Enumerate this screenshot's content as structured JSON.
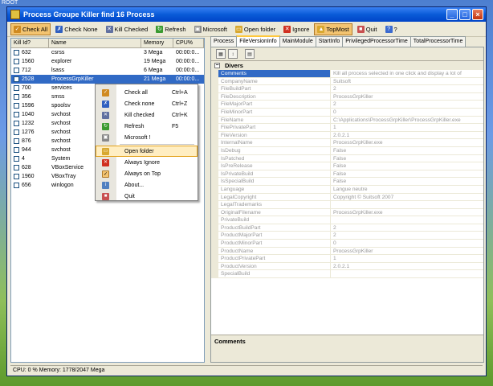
{
  "desktop_label": "ROOT",
  "window": {
    "title": "Process Groupe Killer find 16 Process",
    "buttons": [
      "_",
      "□",
      "×"
    ]
  },
  "toolbar": [
    {
      "label": "Check All",
      "icon": "check-all-icon",
      "color": "#d08a20",
      "pressed": true
    },
    {
      "label": "Check None",
      "icon": "check-none-icon",
      "color": "#3060c0",
      "pressed": false
    },
    {
      "label": "Kill Checked",
      "icon": "kill-icon",
      "color": "#6070a0",
      "pressed": false
    },
    {
      "label": "Refresh",
      "icon": "refresh-icon",
      "color": "#3a9a30",
      "pressed": false
    },
    {
      "label": "Microsoft",
      "icon": "microsoft-icon",
      "color": "#888888",
      "pressed": false
    },
    {
      "label": "Open folder",
      "icon": "folder-icon",
      "color": "#d8a830",
      "pressed": false
    },
    {
      "label": "Ignore",
      "icon": "ignore-icon",
      "color": "#d03020",
      "pressed": false
    },
    {
      "label": "TopMost",
      "icon": "topmost-icon",
      "color": "#d8a830",
      "pressed": true
    },
    {
      "label": "Quit",
      "icon": "quit-icon",
      "color": "#c85050",
      "pressed": false
    },
    {
      "label": "?",
      "icon": "help-icon",
      "color": "#3a6ad0",
      "pressed": false
    }
  ],
  "process_list": {
    "columns": [
      "Kill Id?",
      "Name",
      "Memory",
      "CPU%"
    ],
    "rows": [
      {
        "id": "632",
        "name": "csrss",
        "memory": "3 Mega",
        "cpu": "00:00:0..."
      },
      {
        "id": "1560",
        "name": "explorer",
        "memory": "19 Mega",
        "cpu": "00:00:0..."
      },
      {
        "id": "712",
        "name": "lsass",
        "memory": "6 Mega",
        "cpu": "00:00:0..."
      },
      {
        "id": "2528",
        "name": "ProcessGrpKiller",
        "memory": "21 Mega",
        "cpu": "00:00:0..."
      },
      {
        "id": "700",
        "name": "services",
        "memory": "",
        "cpu": ""
      },
      {
        "id": "356",
        "name": "smss",
        "memory": "",
        "cpu": ""
      },
      {
        "id": "1596",
        "name": "spoolsv",
        "memory": "",
        "cpu": ""
      },
      {
        "id": "1040",
        "name": "svchost",
        "memory": "",
        "cpu": ""
      },
      {
        "id": "1232",
        "name": "svchost",
        "memory": "",
        "cpu": ""
      },
      {
        "id": "1276",
        "name": "svchost",
        "memory": "",
        "cpu": ""
      },
      {
        "id": "876",
        "name": "svchost",
        "memory": "",
        "cpu": ""
      },
      {
        "id": "944",
        "name": "svchost",
        "memory": "",
        "cpu": ""
      },
      {
        "id": "4",
        "name": "System",
        "memory": "",
        "cpu": ""
      },
      {
        "id": "628",
        "name": "VBoxService",
        "memory": "",
        "cpu": ""
      },
      {
        "id": "1960",
        "name": "VBoxTray",
        "memory": "",
        "cpu": ""
      },
      {
        "id": "656",
        "name": "winlogon",
        "memory": "",
        "cpu": ""
      }
    ]
  },
  "context_menu": [
    {
      "label": "Check all",
      "shortcut": "Ctrl+A",
      "icon": "check-all-icon",
      "color": "#d08a20"
    },
    {
      "label": "Check none",
      "shortcut": "Ctrl+Z",
      "icon": "check-none-icon",
      "color": "#3060c0"
    },
    {
      "label": "Kill checked",
      "shortcut": "Ctrl+K",
      "icon": "kill-icon",
      "color": "#6070a0"
    },
    {
      "label": "Refresh",
      "shortcut": "F5",
      "icon": "refresh-icon",
      "color": "#3a9a30"
    },
    {
      "label": "Microsoft !",
      "shortcut": "",
      "icon": "microsoft-icon",
      "color": "#888888"
    },
    {
      "sep": true
    },
    {
      "label": "Open folder",
      "shortcut": "",
      "icon": "folder-icon",
      "color": "#d8a830",
      "highlight": true
    },
    {
      "label": "Always Ignore",
      "shortcut": "",
      "icon": "ignore-icon",
      "color": "#d03020"
    },
    {
      "label": "Always on Top",
      "shortcut": "",
      "icon": "topmost-icon",
      "color": "#d8a830",
      "checked": true
    },
    {
      "label": "About...",
      "shortcut": "",
      "icon": "about-icon",
      "color": "#5080c0"
    },
    {
      "label": "Quit",
      "shortcut": "",
      "icon": "quit-icon",
      "color": "#c85050"
    }
  ],
  "tabs": [
    "Process",
    "FileVersionInfo",
    "MainModule",
    "StartInfo",
    "PrivilegedProcessorTime",
    "TotalProcessorTime"
  ],
  "active_tab": "FileVersionInfo",
  "property_grid": {
    "category": "Divers",
    "rows": [
      {
        "name": "Comments",
        "value": "Kill all process selected in one click and display a lot of"
      },
      {
        "name": "CompanyName",
        "value": "Suitsoft"
      },
      {
        "name": "FileBuildPart",
        "value": "2"
      },
      {
        "name": "FileDescription",
        "value": "ProcessGrpKiller"
      },
      {
        "name": "FileMajorPart",
        "value": "2"
      },
      {
        "name": "FileMinorPart",
        "value": "0"
      },
      {
        "name": "FileName",
        "value": "C:\\Applications\\ProcessGrpKiller\\ProcessGrpKiller.exe"
      },
      {
        "name": "FilePrivatePart",
        "value": "1"
      },
      {
        "name": "FileVersion",
        "value": "2.0.2.1"
      },
      {
        "name": "InternalName",
        "value": "ProcessGrpKiller.exe"
      },
      {
        "name": "IsDebug",
        "value": "False"
      },
      {
        "name": "IsPatched",
        "value": "False"
      },
      {
        "name": "IsPreRelease",
        "value": "False"
      },
      {
        "name": "IsPrivateBuild",
        "value": "False"
      },
      {
        "name": "IsSpecialBuild",
        "value": "False"
      },
      {
        "name": "Language",
        "value": "Langue neutre"
      },
      {
        "name": "LegalCopyright",
        "value": "Copyright © Suitsoft 2007"
      },
      {
        "name": "LegalTrademarks",
        "value": ""
      },
      {
        "name": "OriginalFilename",
        "value": "ProcessGrpKiller.exe"
      },
      {
        "name": "PrivateBuild",
        "value": ""
      },
      {
        "name": "ProductBuildPart",
        "value": "2"
      },
      {
        "name": "ProductMajorPart",
        "value": "2"
      },
      {
        "name": "ProductMinorPart",
        "value": "0"
      },
      {
        "name": "ProductName",
        "value": "ProcessGrpKiller"
      },
      {
        "name": "ProductPrivatePart",
        "value": "1"
      },
      {
        "name": "ProductVersion",
        "value": "2.0.2.1"
      },
      {
        "name": "SpecialBuild",
        "value": ""
      }
    ]
  },
  "comments_label": "Comments",
  "status": "CPU: 0 % Memory: 1778/2047 Mega"
}
